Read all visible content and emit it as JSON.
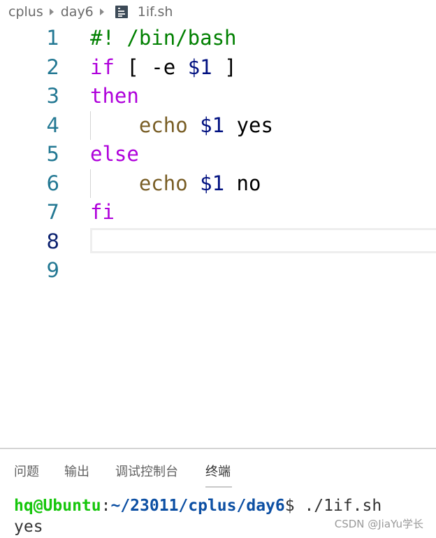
{
  "breadcrumb": {
    "items": [
      "cplus",
      "day6"
    ],
    "file": "1if.sh",
    "file_icon": "text-file-icon",
    "separator_icon": "chevron-right-icon"
  },
  "editor": {
    "language": "bash",
    "active_line": 8,
    "lines": [
      {
        "n": "1",
        "tokens": [
          {
            "t": "#! /bin/bash",
            "c": "comment"
          }
        ]
      },
      {
        "n": "2",
        "tokens": [
          {
            "t": "if",
            "c": "kw"
          },
          {
            "t": " [ -e ",
            "c": "plain"
          },
          {
            "t": "$1",
            "c": "var"
          },
          {
            "t": " ]",
            "c": "plain"
          }
        ]
      },
      {
        "n": "3",
        "tokens": [
          {
            "t": "then",
            "c": "kw"
          }
        ]
      },
      {
        "n": "4",
        "indent": true,
        "tokens": [
          {
            "t": "    ",
            "c": "plain"
          },
          {
            "t": "echo",
            "c": "fn"
          },
          {
            "t": " ",
            "c": "plain"
          },
          {
            "t": "$1",
            "c": "var"
          },
          {
            "t": " yes",
            "c": "plain"
          }
        ]
      },
      {
        "n": "5",
        "tokens": [
          {
            "t": "else",
            "c": "kw"
          }
        ]
      },
      {
        "n": "6",
        "indent": true,
        "tokens": [
          {
            "t": "    ",
            "c": "plain"
          },
          {
            "t": "echo",
            "c": "fn"
          },
          {
            "t": " ",
            "c": "plain"
          },
          {
            "t": "$1",
            "c": "var"
          },
          {
            "t": " no",
            "c": "plain"
          }
        ]
      },
      {
        "n": "7",
        "tokens": [
          {
            "t": "fi",
            "c": "kw"
          }
        ]
      },
      {
        "n": "8",
        "tokens": []
      },
      {
        "n": "9",
        "tokens": []
      }
    ]
  },
  "panel": {
    "tabs": [
      {
        "label": "问题",
        "active": false
      },
      {
        "label": "输出",
        "active": false
      },
      {
        "label": "调试控制台",
        "active": false
      },
      {
        "label": "终端",
        "active": true
      }
    ],
    "terminal": {
      "prompt_user": "hq@Ubuntu",
      "prompt_sep": ":",
      "prompt_path": "~/23011/cplus/day6",
      "prompt_symbol": "$",
      "command": " ./1if.sh",
      "output": "yes"
    }
  },
  "watermark": "CSDN @JiaYu学长",
  "colors": {
    "comment": "#008000",
    "keyword": "#af00db",
    "variable": "#001080",
    "function": "#795e26",
    "line_number": "#237893",
    "line_number_active": "#0b216f",
    "terminal_user": "#16c60c",
    "terminal_path": "#0c4fa3"
  }
}
